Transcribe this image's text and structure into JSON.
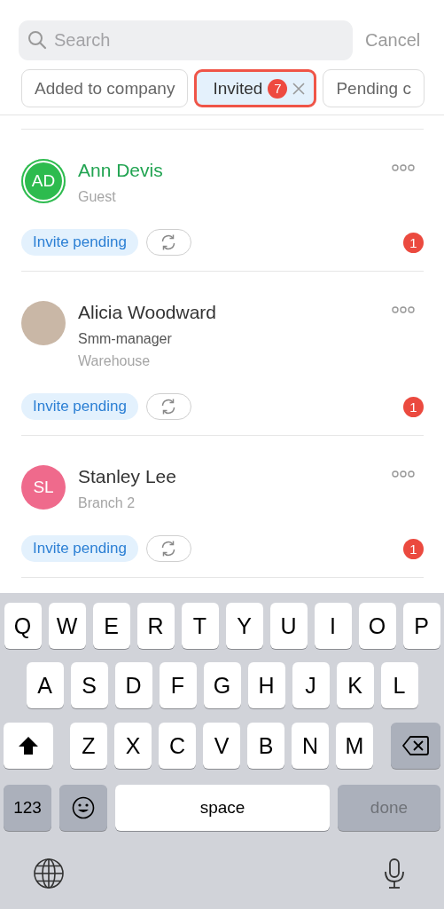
{
  "search": {
    "placeholder": "Search"
  },
  "cancel": "Cancel",
  "filters": [
    {
      "label": "Added to company",
      "selected": false
    },
    {
      "label": "Invited",
      "selected": true,
      "count": "7"
    },
    {
      "label": "Pending c",
      "selected": false
    }
  ],
  "contacts": [
    {
      "name": "Ann Devis",
      "highlighted": true,
      "avatar": {
        "kind": "initials",
        "text": "AD",
        "color": "#2dbb4e"
      },
      "details": [
        {
          "kind": "note",
          "text": "Guest"
        }
      ],
      "status": "Invite pending",
      "unread": "1"
    },
    {
      "name": "Alicia Woodward",
      "highlighted": false,
      "avatar": {
        "kind": "photo"
      },
      "details": [
        {
          "kind": "role",
          "text": "Smm-manager"
        },
        {
          "kind": "note",
          "text": "Warehouse"
        }
      ],
      "status": "Invite pending",
      "unread": "1"
    },
    {
      "name": "Stanley Lee",
      "highlighted": false,
      "avatar": {
        "kind": "initials",
        "text": "SL",
        "color": "#ef6a8c"
      },
      "details": [
        {
          "kind": "note",
          "text": "Branch 2"
        }
      ],
      "status": "Invite pending",
      "unread": "1"
    }
  ],
  "keyboard": {
    "rows": [
      [
        {
          "kind": "letter",
          "label": "Q"
        },
        {
          "kind": "letter",
          "label": "W"
        },
        {
          "kind": "letter",
          "label": "E"
        },
        {
          "kind": "letter",
          "label": "R"
        },
        {
          "kind": "letter",
          "label": "T"
        },
        {
          "kind": "letter",
          "label": "Y"
        },
        {
          "kind": "letter",
          "label": "U"
        },
        {
          "kind": "letter",
          "label": "I"
        },
        {
          "kind": "letter",
          "label": "O"
        },
        {
          "kind": "letter",
          "label": "P"
        }
      ],
      [
        {
          "kind": "letter",
          "label": "A"
        },
        {
          "kind": "letter",
          "label": "S"
        },
        {
          "kind": "letter",
          "label": "D"
        },
        {
          "kind": "letter",
          "label": "F"
        },
        {
          "kind": "letter",
          "label": "G"
        },
        {
          "kind": "letter",
          "label": "H"
        },
        {
          "kind": "letter",
          "label": "J"
        },
        {
          "kind": "letter",
          "label": "K"
        },
        {
          "kind": "letter",
          "label": "L"
        }
      ],
      [
        {
          "kind": "shift"
        },
        {
          "kind": "letter",
          "label": "Z"
        },
        {
          "kind": "letter",
          "label": "X"
        },
        {
          "kind": "letter",
          "label": "C"
        },
        {
          "kind": "letter",
          "label": "V"
        },
        {
          "kind": "letter",
          "label": "B"
        },
        {
          "kind": "letter",
          "label": "N"
        },
        {
          "kind": "letter",
          "label": "M"
        },
        {
          "kind": "backspace"
        }
      ]
    ],
    "bottom_keys": [
      {
        "kind": "mode",
        "label": "123"
      },
      {
        "kind": "emoji"
      },
      {
        "kind": "space",
        "label": "space"
      },
      {
        "kind": "action",
        "label": "done",
        "disabled": true
      }
    ]
  }
}
